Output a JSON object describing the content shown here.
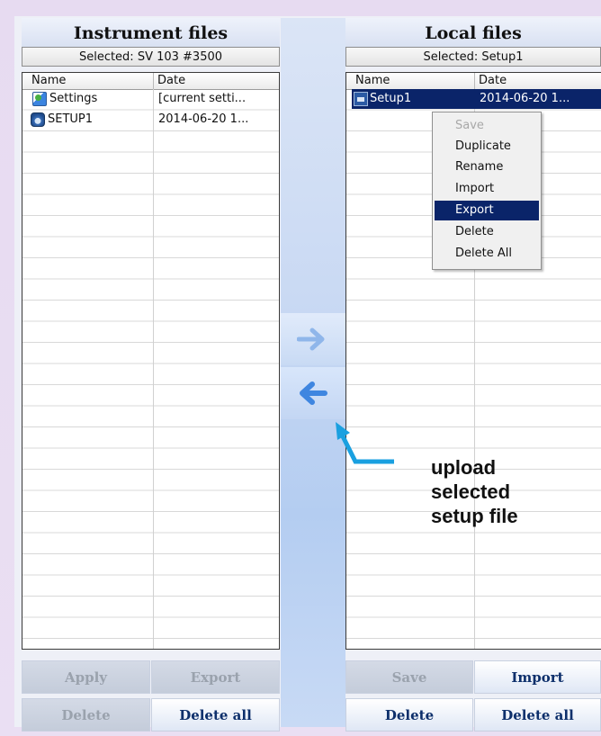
{
  "left_panel": {
    "title": "Instrument files",
    "selected": "Selected: SV 103 #3500",
    "columns": [
      "Name",
      "Date"
    ],
    "rows": [
      {
        "name": "Settings",
        "date": "[current setti...",
        "icon": "settings-icon"
      },
      {
        "name": "SETUP1",
        "date": "2014-06-20 1...",
        "icon": "meter-icon"
      }
    ],
    "buttons": {
      "apply": "Apply",
      "export": "Export",
      "delete": "Delete",
      "delete_all": "Delete all"
    }
  },
  "right_panel": {
    "title": "Local files",
    "selected": "Selected: Setup1",
    "columns": [
      "Name",
      "Date"
    ],
    "rows": [
      {
        "name": "Setup1",
        "date": "2014-06-20 1...",
        "icon": "file-icon",
        "selected": true
      }
    ],
    "buttons": {
      "save": "Save",
      "import": "Import",
      "delete": "Delete",
      "delete_all": "Delete all"
    }
  },
  "transfer": {
    "download_icon": "arrow-right-icon",
    "upload_icon": "arrow-left-icon"
  },
  "context_menu": {
    "items": [
      {
        "label": "Save",
        "state": "disabled"
      },
      {
        "label": "Duplicate",
        "state": "normal"
      },
      {
        "label": "Rename",
        "state": "normal"
      },
      {
        "label": "Import",
        "state": "normal"
      },
      {
        "label": "Export",
        "state": "highlighted"
      },
      {
        "label": "Delete",
        "state": "normal"
      },
      {
        "label": "Delete All",
        "state": "normal"
      }
    ]
  },
  "callout": {
    "line1": "upload",
    "line2": "selected",
    "line3": "setup file",
    "color": "#1aa0e0"
  },
  "colors": {
    "selection": "#0a2469",
    "button_text": "#0d2f6b",
    "arrow": "#3f86e0"
  }
}
